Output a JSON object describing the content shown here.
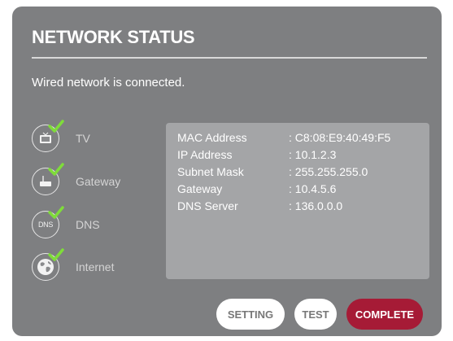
{
  "dialog": {
    "title": "NETWORK STATUS",
    "status_message": "Wired network is connected."
  },
  "connections": [
    {
      "label": "TV",
      "icon": "tv-icon",
      "status": "ok"
    },
    {
      "label": "Gateway",
      "icon": "router-icon",
      "status": "ok"
    },
    {
      "label": "DNS",
      "icon": "dns-icon",
      "icon_text": "DNS",
      "status": "ok"
    },
    {
      "label": "Internet",
      "icon": "globe-icon",
      "status": "ok"
    }
  ],
  "details": [
    {
      "key": "MAC Address",
      "value": ": C8:08:E9:40:49:F5"
    },
    {
      "key": "IP Address",
      "value": ": 10.1.2.3"
    },
    {
      "key": "Subnet Mask",
      "value": ": 255.255.255.0"
    },
    {
      "key": "Gateway",
      "value": ": 10.4.5.6"
    },
    {
      "key": "DNS Server",
      "value": ": 136.0.0.0"
    }
  ],
  "buttons": {
    "setting": "SETTING",
    "test": "TEST",
    "complete": "COMPLETE"
  },
  "colors": {
    "dialog_bg": "#7e7f81",
    "panel_bg": "#a4a5a7",
    "check": "#7fdc3a",
    "complete_button": "#a61b36"
  }
}
